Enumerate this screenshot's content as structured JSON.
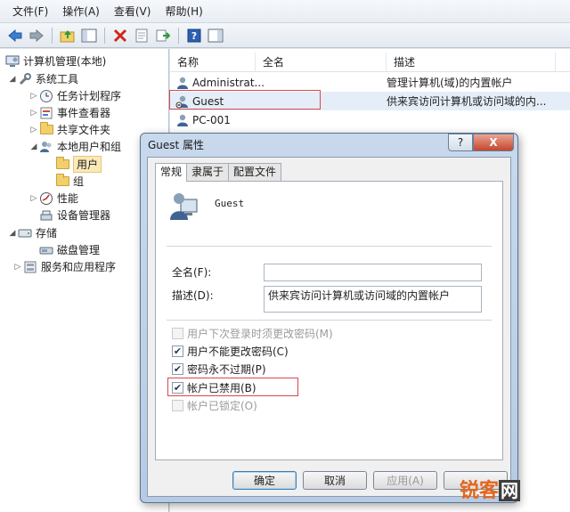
{
  "menu": [
    "文件(F)",
    "操作(A)",
    "查看(V)",
    "帮助(H)"
  ],
  "toolbar": {
    "icons": [
      "back-arrow-icon",
      "forward-arrow-icon",
      "up-folder-icon",
      "show-hide-tree-icon",
      "delete-icon",
      "properties-icon",
      "export-icon",
      "help-icon",
      "action-pane-icon"
    ]
  },
  "tree": {
    "root": "计算机管理(本地)",
    "system_tools": "系统工具",
    "task_scheduler": "任务计划程序",
    "event_viewer": "事件查看器",
    "shared_folders": "共享文件夹",
    "local_users_groups": "本地用户和组",
    "users": "用户",
    "groups": "组",
    "performance": "性能",
    "device_manager": "设备管理器",
    "storage": "存储",
    "disk_management": "磁盘管理",
    "services_apps": "服务和应用程序"
  },
  "list": {
    "columns": [
      "名称",
      "全名",
      "描述"
    ],
    "rows": [
      {
        "name": "Administrat...",
        "fullname": "",
        "desc": "管理计算机(域)的内置帐户"
      },
      {
        "name": "Guest",
        "fullname": "",
        "desc": "供来宾访问计算机或访问域的内..."
      },
      {
        "name": "PC-001",
        "fullname": "",
        "desc": ""
      }
    ]
  },
  "dialog": {
    "title": "Guest 属性",
    "help": "?",
    "close": "X",
    "tabs": [
      "常规",
      "隶属于",
      "配置文件"
    ],
    "username": "Guest",
    "fullname_label": "全名(F):",
    "fullname_value": "",
    "desc_label": "描述(D):",
    "desc_value": "供来宾访问计算机或访问域的内置帐户",
    "checkboxes": [
      {
        "label": "用户下次登录时须更改密码(M)",
        "checked": false,
        "disabled": true
      },
      {
        "label": "用户不能更改密码(C)",
        "checked": true,
        "disabled": false
      },
      {
        "label": "密码永不过期(P)",
        "checked": true,
        "disabled": false
      },
      {
        "label": "帐户已禁用(B)",
        "checked": true,
        "disabled": false
      },
      {
        "label": "帐户已锁定(O)",
        "checked": false,
        "disabled": true
      }
    ],
    "buttons": {
      "ok": "确定",
      "cancel": "取消",
      "apply": "应用(A)",
      "help": ""
    }
  },
  "watermark": {
    "part1": "锐客",
    "part2": "网"
  },
  "colors": {
    "highlight_box": "#d9474f",
    "watermark": "#e2661d"
  }
}
